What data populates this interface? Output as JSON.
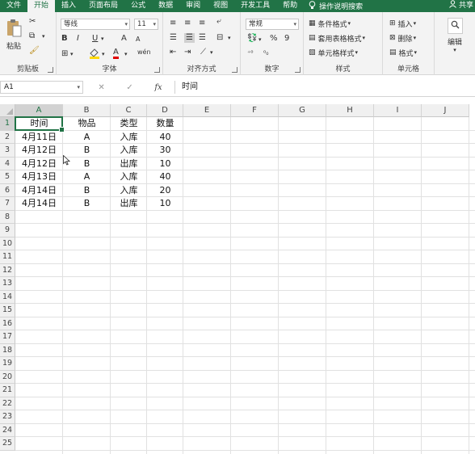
{
  "menu": {
    "tabs": [
      "文件",
      "开始",
      "插入",
      "页面布局",
      "公式",
      "数据",
      "审阅",
      "视图",
      "开发工具",
      "帮助"
    ],
    "active_index": 1,
    "tell_me": "操作说明搜索",
    "share": "共享"
  },
  "ribbon": {
    "clipboard": {
      "label": "剪贴板",
      "paste": "粘贴"
    },
    "font": {
      "label": "字体",
      "font_name": "等线",
      "font_size": "11",
      "bold": "B",
      "italic": "I",
      "underline": "U",
      "increase": "A",
      "decrease": "A",
      "font_color": "A",
      "wen": "wén"
    },
    "alignment": {
      "label": "对齐方式"
    },
    "number": {
      "label": "数字",
      "format": "常规",
      "percent": "%",
      "comma": "9"
    },
    "styles": {
      "label": "样式",
      "conditional": "条件格式",
      "table": "套用表格格式",
      "cell_styles": "单元格样式"
    },
    "cells": {
      "label": "单元格",
      "insert": "插入",
      "delete": "删除",
      "format": "格式"
    },
    "editing": {
      "label": "编辑"
    }
  },
  "formula_bar": {
    "name_box": "A1",
    "cancel": "✕",
    "confirm": "✓",
    "fx": "fx",
    "content": "时间"
  },
  "sheet": {
    "columns": [
      "A",
      "B",
      "C",
      "D",
      "E",
      "F",
      "G",
      "H",
      "I",
      "J"
    ],
    "rows": [
      "1",
      "2",
      "3",
      "4",
      "5",
      "6",
      "7",
      "8",
      "9",
      "10",
      "11",
      "12",
      "13",
      "14",
      "15",
      "16",
      "17",
      "18",
      "19",
      "20",
      "21",
      "22",
      "23",
      "24",
      "25"
    ],
    "data": [
      [
        "时间",
        "物品",
        "类型",
        "数量"
      ],
      [
        "4月11日",
        "A",
        "入库",
        "40"
      ],
      [
        "4月12日",
        "B",
        "入库",
        "30"
      ],
      [
        "4月12日",
        "B",
        "出库",
        "10"
      ],
      [
        "4月13日",
        "A",
        "入库",
        "40"
      ],
      [
        "4月14日",
        "B",
        "入库",
        "20"
      ],
      [
        "4月14日",
        "B",
        "出库",
        "10"
      ]
    ]
  }
}
